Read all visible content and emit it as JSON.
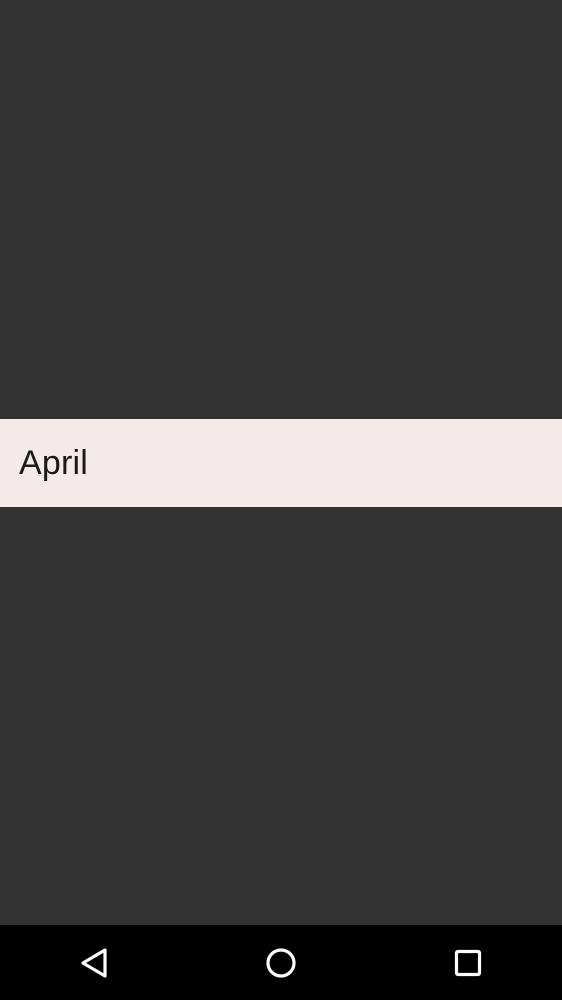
{
  "dropdown": {
    "selected_item": "April"
  },
  "navigation_bar": {
    "buttons": [
      "back-icon",
      "home-icon",
      "recents-icon"
    ],
    "icon_color": "#ffffff",
    "background": "#000000"
  },
  "colors": {
    "screen_background": "#333333",
    "popup_background": "#f4eaea",
    "text": "#1a1a1a"
  }
}
